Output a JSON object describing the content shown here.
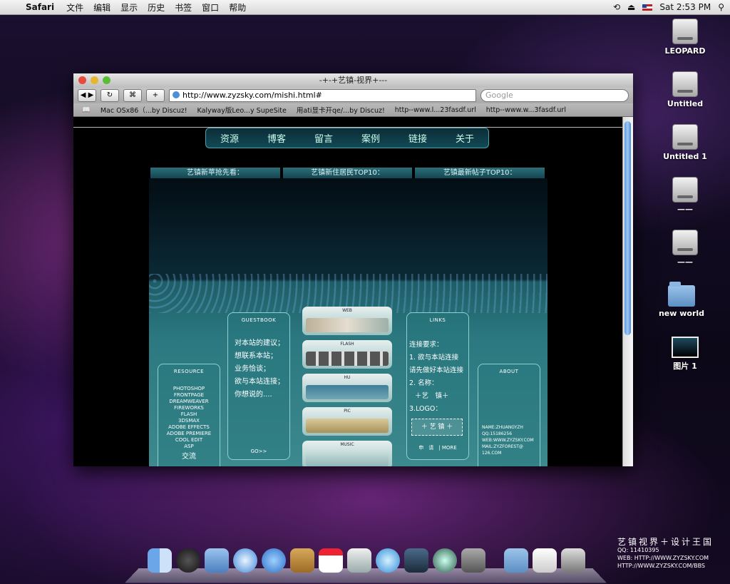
{
  "menubar": {
    "app": "Safari",
    "items": [
      "文件",
      "编辑",
      "显示",
      "历史",
      "书签",
      "窗口",
      "帮助"
    ],
    "clock": "Sat 2:53 PM"
  },
  "desktop": {
    "icons": [
      {
        "label": "LEOPARD",
        "kind": "hdd"
      },
      {
        "label": "Untitled",
        "kind": "hdd"
      },
      {
        "label": "Untitled 1",
        "kind": "hdd"
      },
      {
        "label": "——",
        "kind": "hdd"
      },
      {
        "label": "——",
        "kind": "hdd"
      },
      {
        "label": "new world",
        "kind": "folder"
      },
      {
        "label": "图片 1",
        "kind": "image"
      }
    ]
  },
  "browser": {
    "title": "-+-+艺镇-视界+---",
    "url": "http://www.zyzsky.com/mishi.html#",
    "search_placeholder": "Google",
    "bookmarks": [
      "Mac OSx86（...by Discuz!",
      "Kalyway版Leo...y SupeSite",
      "用ati显卡开qe/...by Discuz!",
      "http--www.l...23fasdf.url",
      "http--www.w...3fasdf.url"
    ]
  },
  "site": {
    "nav": [
      "资源",
      "博客",
      "留言",
      "案例",
      "链接",
      "关于"
    ],
    "section_tabs": [
      "艺镇新苹抢先看：",
      "艺镇新住居民TOP10：",
      "艺镇最新帖子TOP10："
    ],
    "resource": {
      "head": "RESOURCE",
      "items": [
        "PHOTOSHOP",
        "FRONTPAGE",
        "DREAMWEAVER",
        "FIREWORKS",
        "FLASH",
        "3DSMAX",
        "ADOBE EFFECTS",
        "ADOBE PREMIERE",
        "COOL EDIT",
        "ASP"
      ],
      "extra": "交流"
    },
    "guestbook": {
      "head": "GUESTBOOK",
      "lines": [
        "对本站的建议；",
        "想联系本站；",
        "业务恰谈；",
        "欲与本站连接；",
        "你想说的...."
      ],
      "go": "GO>>"
    },
    "menu_cards": [
      "WEB",
      "FLASH",
      "HU",
      "PIC",
      "MUSIC"
    ],
    "links": {
      "head": "LINKS",
      "lines": [
        "连接要求：",
        "1. 欲与本站连接",
        "请先做好本站连接",
        "2. 名称：",
        "＋艺　镇＋",
        "3.LOGO："
      ],
      "logo": "＋ 艺 镇 ＋",
      "footer": "申　请　| MORE"
    },
    "about": {
      "head": "ABOUT",
      "lines": [
        "NAME:ZHUANGYZH",
        "QQ:15186256",
        "WEB:WWW.ZYZSKY.COM",
        "MAIL:ZYZFOREST@",
        "126.COM"
      ]
    }
  },
  "watermark": {
    "line1": "艺镇视界＋设计王国",
    "line2": "QQ:        11410395",
    "line3": "WEB: HTTP://WWW.ZYZSKY.COM",
    "line4": "HTTP://WWW.ZYZSKY.COM/BBS"
  }
}
